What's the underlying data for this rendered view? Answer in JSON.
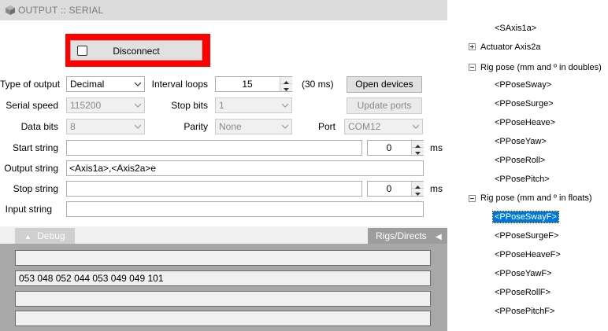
{
  "window": {
    "title": "OUTPUT :: SERIAL"
  },
  "connection": {
    "disconnect_label": "Disconnect",
    "checked": false
  },
  "form": {
    "type_of_output": {
      "label": "Type of output",
      "value": "Decimal"
    },
    "interval_loops": {
      "label": "Interval loops",
      "value": "15",
      "unit": "(30 ms)"
    },
    "open_devices_label": "Open devices",
    "serial_speed": {
      "label": "Serial speed",
      "value": "115200"
    },
    "stop_bits": {
      "label": "Stop bits",
      "value": "1"
    },
    "update_ports_label": "Update ports",
    "data_bits": {
      "label": "Data bits",
      "value": "8"
    },
    "parity": {
      "label": "Parity",
      "value": "None"
    },
    "port": {
      "label": "Port",
      "value": "COM12"
    },
    "start_string": {
      "label": "Start string",
      "value": "",
      "delay": "0",
      "unit": "ms"
    },
    "output_string": {
      "label": "Output string",
      "value": "<Axis1a>,<Axis2a>e"
    },
    "stop_string": {
      "label": "Stop string",
      "value": "",
      "delay": "0",
      "unit": "ms"
    },
    "input_string": {
      "label": "Input string",
      "value": ""
    }
  },
  "tabs": {
    "debug_label": "Debug",
    "debug_arrow": "▲",
    "rigs_label": "Rigs/Directs",
    "rigs_arrow": "◀"
  },
  "debug_lines": [
    "",
    "053 048 052 044 053 049 049 101",
    "",
    ""
  ],
  "tree": {
    "items": [
      {
        "label": "<SAxis1a>",
        "kind": "child"
      },
      {
        "label": "Actuator Axis2a",
        "kind": "parent",
        "expander": "+"
      },
      {
        "label": "Rig pose (mm and º in doubles)",
        "kind": "parent",
        "expander": "-"
      },
      {
        "label": "<PPoseSway>",
        "kind": "child"
      },
      {
        "label": "<PPoseSurge>",
        "kind": "child"
      },
      {
        "label": "<PPoseHeave>",
        "kind": "child"
      },
      {
        "label": "<PPoseYaw>",
        "kind": "child"
      },
      {
        "label": "<PPoseRoll>",
        "kind": "child"
      },
      {
        "label": "<PPosePitch>",
        "kind": "child"
      },
      {
        "label": "Rig pose (mm and º in floats)",
        "kind": "parent",
        "expander": "-"
      },
      {
        "label": "<PPoseSwayF>",
        "kind": "child",
        "selected": true
      },
      {
        "label": "<PPoseSurgeF>",
        "kind": "child"
      },
      {
        "label": "<PPoseHeaveF>",
        "kind": "child"
      },
      {
        "label": "<PPoseYawF>",
        "kind": "child"
      },
      {
        "label": "<PPoseRollF>",
        "kind": "child"
      },
      {
        "label": "<PPosePitchF>",
        "kind": "child"
      }
    ]
  },
  "colors": {
    "highlight_frame": "#ff0000",
    "selection": "#0078d7"
  },
  "icons": {
    "title": "cube-icon",
    "dropdown": "chevron-down-icon",
    "spinner": "spin-arrows-icon"
  }
}
